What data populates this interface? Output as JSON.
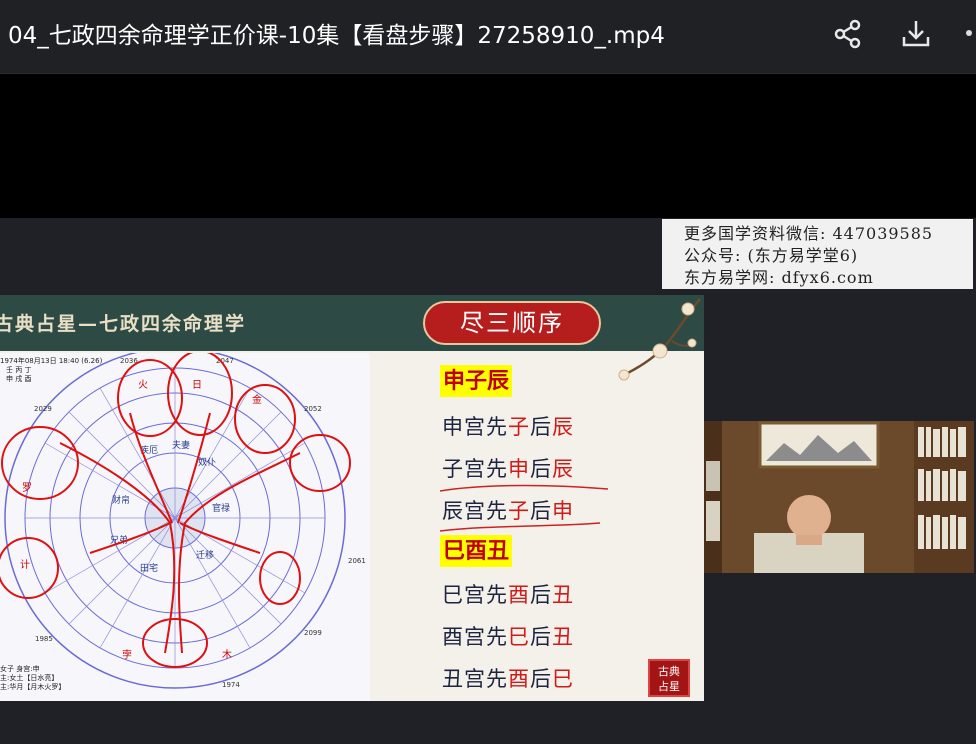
{
  "window": {
    "title": "04_七政四余命理学正价课-10集【看盘步骤】27258910_.mp4",
    "share_icon": "share-icon",
    "download_icon": "download-icon",
    "more_icon": "more-icon"
  },
  "watermark": {
    "line1": "更多国学资料微信: 447039585",
    "line2": "公众号: (东方易学堂6)",
    "line3": "东方易学网: dfyx6.com"
  },
  "slide": {
    "header_title": "古典占星—七政四余命理学",
    "pill_title": "尽三顺序",
    "seal_line1": "古典",
    "seal_line2": "占星",
    "chart_header": [
      "1974年08月13日 18:40 (6.26)",
      "壬 丙 丁",
      "申 戌 酉"
    ],
    "chart_footer": [
      "女子 身宫:申",
      "主:女土【日水亮】",
      "主:华月【月木火罗】"
    ],
    "chart_years": [
      "2036",
      "2047",
      "2029",
      "2052",
      "1985",
      "1974",
      "2061",
      "2099"
    ],
    "groups": [
      {
        "label": "申子辰",
        "rules": [
          {
            "a": "申宫先",
            "b": "子",
            "c": "后",
            "d": "辰"
          },
          {
            "a": "子宫先",
            "b": "申",
            "c": "后",
            "d": "辰"
          },
          {
            "a": "辰宫先",
            "b": "子",
            "c": "后",
            "d": "申"
          }
        ]
      },
      {
        "label": "巳酉丑",
        "rules": [
          {
            "a": "巳宫先",
            "b": "酉",
            "c": "后",
            "d": "丑"
          },
          {
            "a": "酉宫先",
            "b": "巳",
            "c": "后",
            "d": "丑"
          },
          {
            "a": "丑宫先",
            "b": "酉",
            "c": "后",
            "d": "巳"
          }
        ]
      }
    ]
  },
  "colors": {
    "header_green": "#2d4a45",
    "pill_red": "#b61e1e",
    "highlight_yellow": "#ffff00",
    "accent_red": "#d11a1a"
  }
}
